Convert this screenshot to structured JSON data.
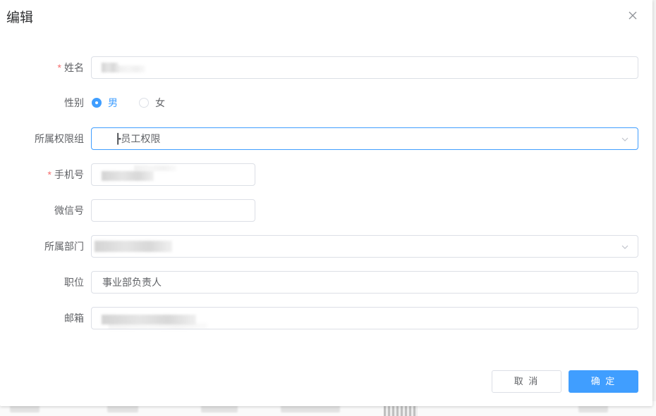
{
  "dialog": {
    "title": "编辑",
    "close_icon": "close-icon"
  },
  "form": {
    "name": {
      "label": "姓名",
      "required_mark": "*",
      "value_redacted": true
    },
    "gender": {
      "label": "性别",
      "options": [
        {
          "label": "男",
          "checked": true
        },
        {
          "label": "女",
          "checked": false
        }
      ]
    },
    "permission_group": {
      "label": "所属权限组",
      "value": "┣员工权限",
      "icon": "chevron-down-icon"
    },
    "phone": {
      "label": "手机号",
      "required_mark": "*",
      "value_redacted": true
    },
    "wechat": {
      "label": "微信号",
      "value": ""
    },
    "department": {
      "label": "所属部门",
      "value_redacted": true,
      "icon": "chevron-down-icon"
    },
    "position": {
      "label": "职位",
      "value": "事业部负责人"
    },
    "email": {
      "label": "邮箱",
      "value_redacted": true
    }
  },
  "footer": {
    "cancel_label": "取 消",
    "confirm_label": "确 定"
  },
  "colors": {
    "primary": "#409eff",
    "required": "#f56c6c",
    "border": "#dcdfe6",
    "text": "#606266",
    "title": "#303133"
  }
}
